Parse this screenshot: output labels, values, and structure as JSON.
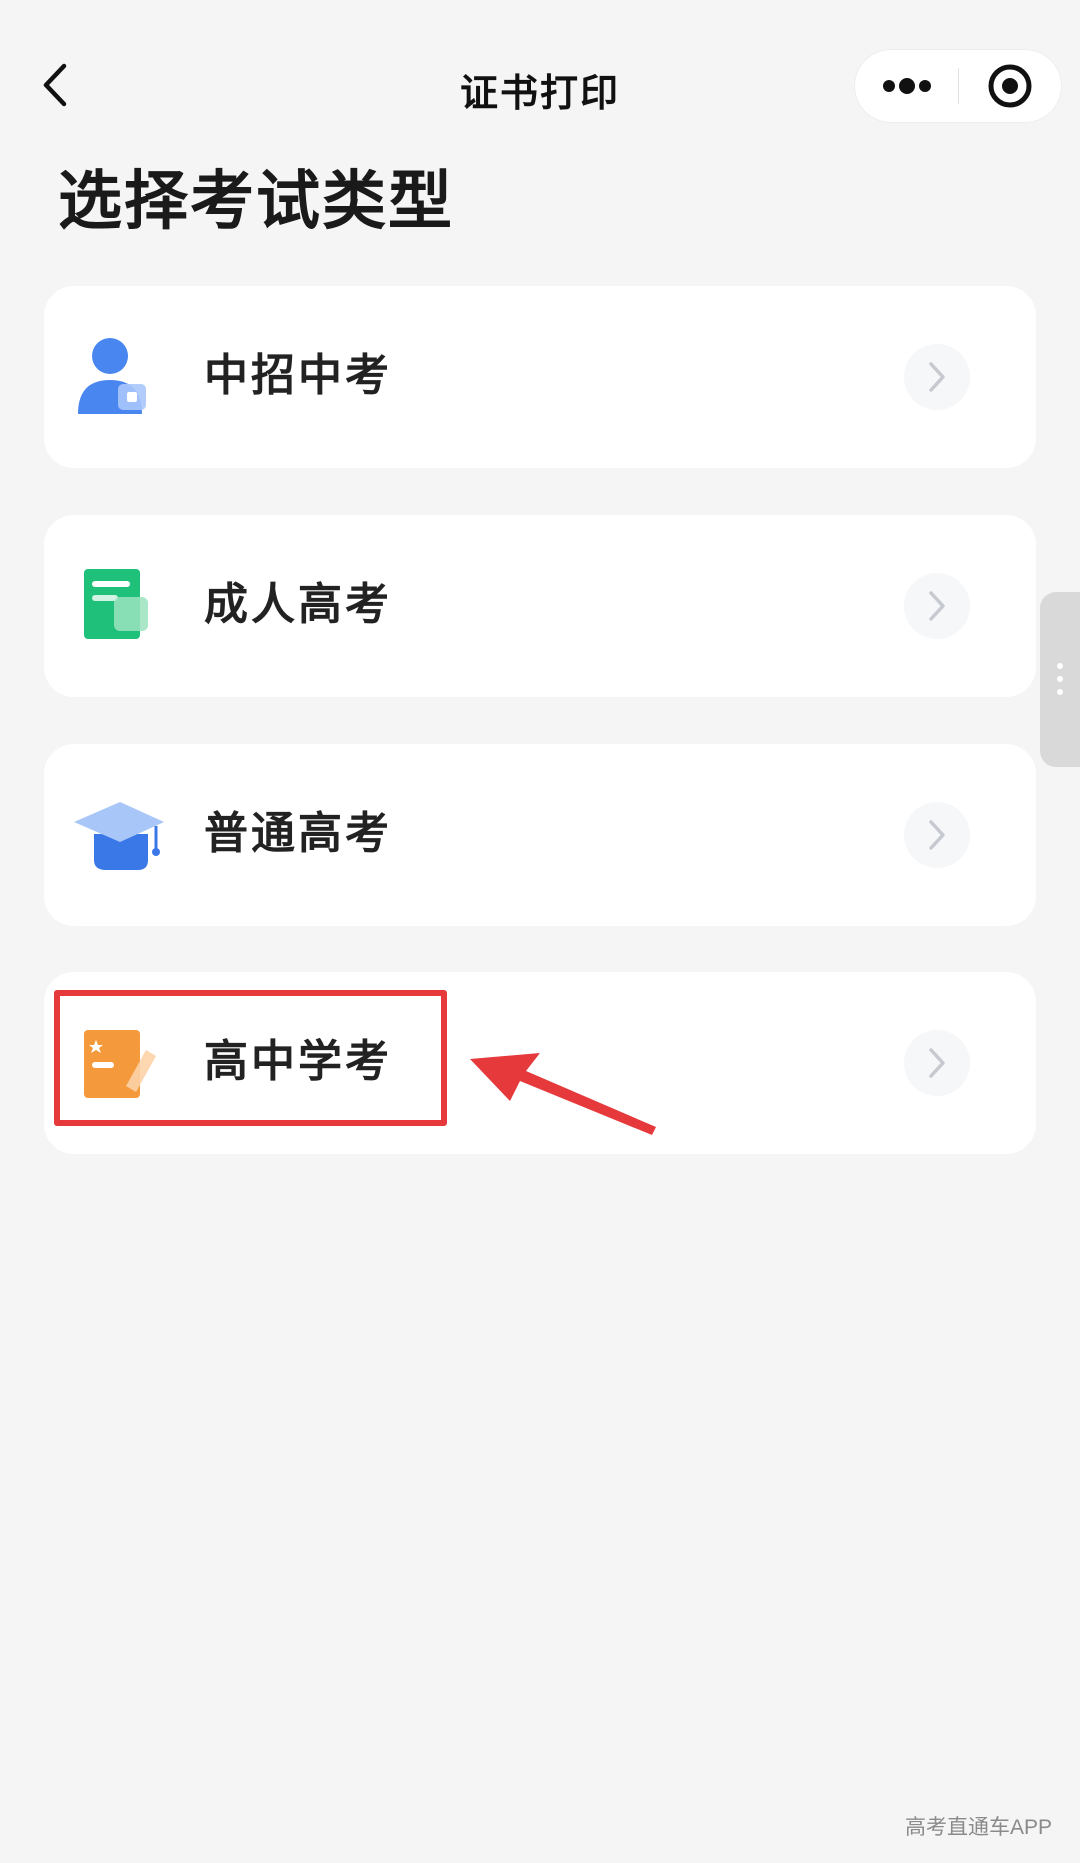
{
  "nav": {
    "title": "证书打印",
    "back_icon": "chevron-left-icon",
    "more_icon": "more-dots-icon",
    "close_icon": "target-circle-icon"
  },
  "page": {
    "heading": "选择考试类型"
  },
  "exam_types": [
    {
      "label": "中招中考",
      "icon": "student-person-icon",
      "icon_color": "#4a86f0"
    },
    {
      "label": "成人高考",
      "icon": "green-document-icon",
      "icon_color": "#1fc07a"
    },
    {
      "label": "普通高考",
      "icon": "graduation-cap-icon",
      "icon_color": "#3a78e8"
    },
    {
      "label": "高中学考",
      "icon": "orange-notebook-icon",
      "icon_color": "#f59a3c"
    }
  ],
  "annotation": {
    "highlight_color": "#e5393c",
    "highlighted_item": "高中学考"
  },
  "watermark": "高考直通车APP"
}
